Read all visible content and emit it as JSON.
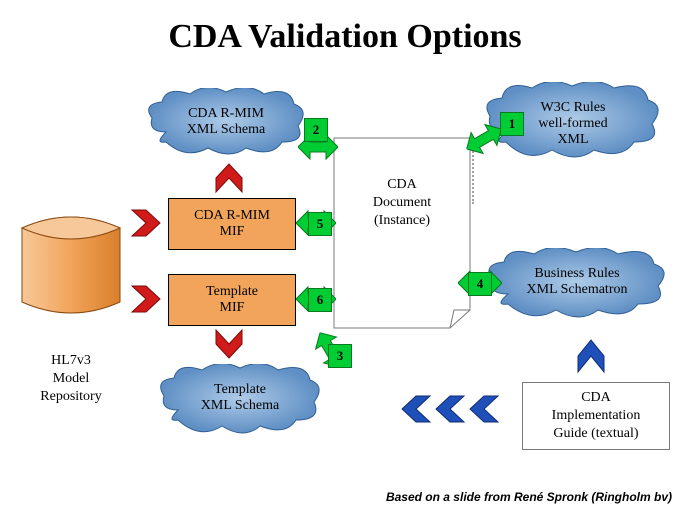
{
  "title": "CDA Validation Options",
  "cylinder": {
    "label": "HL7v3\nModel\nRepository"
  },
  "clouds": {
    "rmim_schema": "CDA R-MIM\nXML Schema",
    "w3c": "W3C Rules\nwell-formed\nXML",
    "business": "Business Rules\nXML Schematron",
    "template_schema": "Template\nXML Schema"
  },
  "boxes": {
    "rmim_mif": "CDA R-MIM\nMIF",
    "template_mif": "Template\nMIF"
  },
  "document": "CDA\nDocument\n(Instance)",
  "guide": "CDA\nImplementation\nGuide (textual)",
  "badges": {
    "b1": "1",
    "b2": "2",
    "b3": "3",
    "b4": "4",
    "b5": "5",
    "b6": "6"
  },
  "footer": "Based on a slide from René Spronk (Ringholm bv)",
  "colors": {
    "cloud": "#7aa6d6",
    "cloudStroke": "#2f5f94",
    "box": "#f2a45a",
    "cyl": "#f2a45a",
    "green": "#00cc33",
    "red": "#d11a1a",
    "blue": "#1f4fb8"
  }
}
